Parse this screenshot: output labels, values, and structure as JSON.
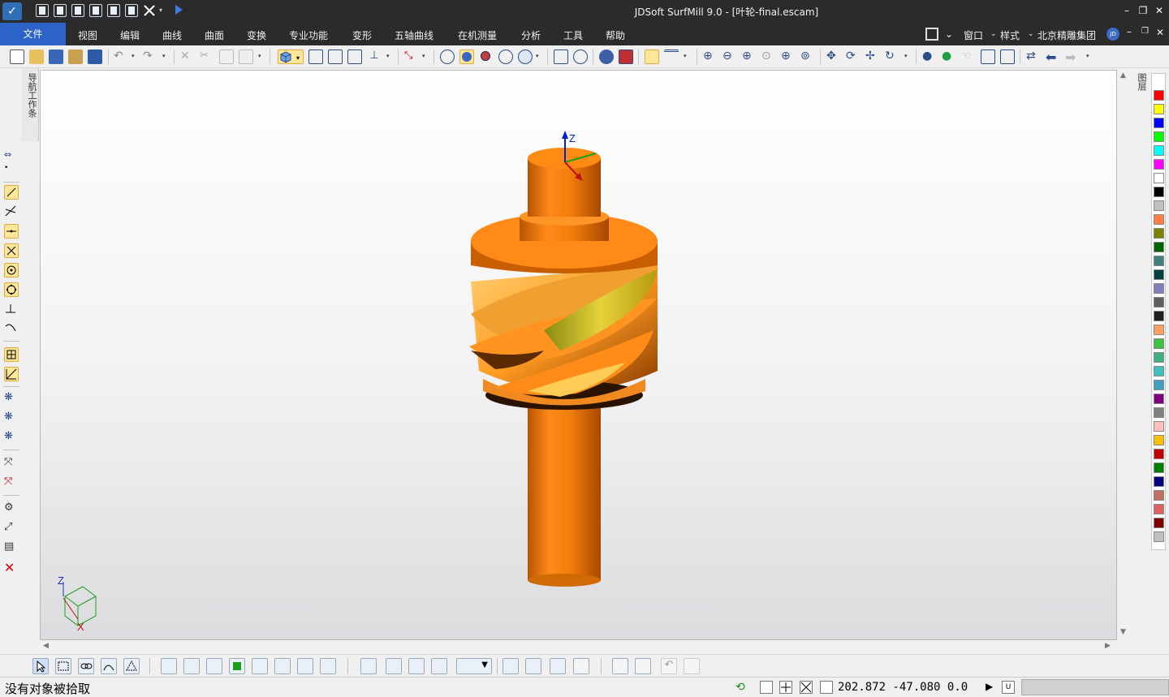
{
  "window": {
    "title": "JDSoft SurfMill 9.0 - [叶轮-final.escam]",
    "minimize": "–",
    "restore": "❐",
    "close": "✕"
  },
  "menubar": {
    "file": "文件",
    "items": [
      "视图",
      "编辑",
      "曲线",
      "曲面",
      "变换",
      "专业功能",
      "变形",
      "五轴曲线",
      "在机测量",
      "分析",
      "工具",
      "帮助"
    ],
    "window_menu": "窗口",
    "style_menu": "样式",
    "company": "北京精雕集团",
    "user_badge": "JD"
  },
  "left_panel": {
    "nav_tab": "导航工作条"
  },
  "right_panel": {
    "layer_tab": "图层",
    "palette": [
      "#ff0000",
      "#ffff00",
      "#0000ff",
      "#00ff00",
      "#00ffff",
      "#ff00ff",
      "#ffffff",
      "#000000",
      "#c0c0c0",
      "#ff8040",
      "#808000",
      "#006400",
      "#408080",
      "#004040",
      "#8080c0",
      "#606060",
      "#202020",
      "#ffa060",
      "#40c040",
      "#40b080",
      "#40c0c0",
      "#40a0c0",
      "#800080",
      "#808080",
      "#ffc0c0",
      "#ffc000",
      "#c00000",
      "#008000",
      "#000080",
      "#c07060",
      "#e06060",
      "#800000",
      "#c0c0c0"
    ]
  },
  "viewport": {
    "axis_label": "Z",
    "triad": {
      "z": "Z",
      "x": "X"
    }
  },
  "status": {
    "message": "没有对象被拾取",
    "coordinates": "202.872 -47.080 0.0",
    "unit_button": "U"
  }
}
